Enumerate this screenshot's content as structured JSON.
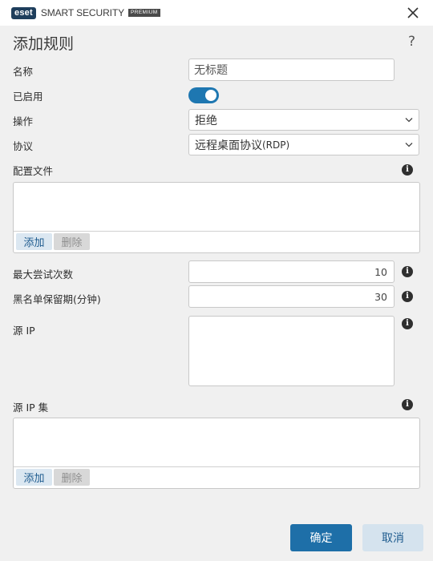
{
  "app": {
    "logo_text": "eset",
    "product_name": "SMART SECURITY",
    "edition": "PREMIUM"
  },
  "dialog": {
    "title": "添加规则",
    "help_symbol": "?"
  },
  "form": {
    "name_label": "名称",
    "name_value": "无标题",
    "enabled_label": "已启用",
    "enabled_value": true,
    "action_label": "操作",
    "action_value": "拒绝",
    "protocol_label": "协议",
    "protocol_value": "远程桌面协议",
    "protocol_suffix": "(RDP)",
    "profiles_label": "配置文件",
    "profiles_add": "添加",
    "profiles_delete": "删除",
    "max_attempts_label": "最大尝试次数",
    "max_attempts_value": "10",
    "blacklist_label": "黑名单保留期(分钟)",
    "blacklist_value": "30",
    "source_ip_label": "源 IP",
    "source_ip_value": "",
    "source_ip_set_label": "源 IP 集",
    "source_ip_set_add": "添加",
    "source_ip_set_delete": "删除"
  },
  "footer": {
    "ok_label": "确定",
    "cancel_label": "取消"
  },
  "colors": {
    "accent": "#1e6fa8",
    "toggle_on": "#1e77b1",
    "background": "#f0f0f0"
  },
  "icons": [
    "close-icon",
    "help-icon",
    "chevron-down-icon",
    "info-icon"
  ]
}
